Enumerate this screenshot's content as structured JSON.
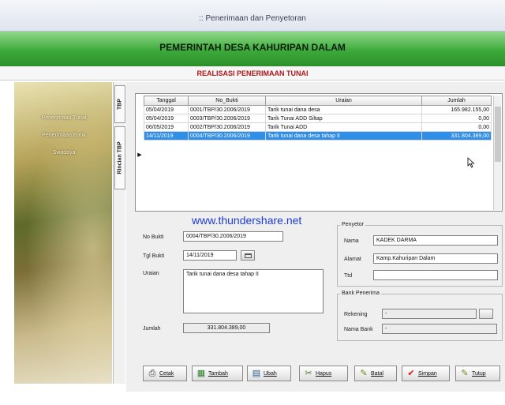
{
  "window": {
    "title": ":: Penerimaan dan Penyetoran"
  },
  "header": {
    "title": "PEMERINTAH DESA KAHURIPAN DALAM",
    "subtitle": "REALISASI PENERIMAAN TUNAI"
  },
  "sidebar": {
    "items": [
      {
        "label": "Penerimaan Tunai"
      },
      {
        "label": "Penerimaan Bank"
      },
      {
        "label": "Swadaya"
      }
    ]
  },
  "side_tabs": [
    {
      "label": "TBP"
    },
    {
      "label": "Rincian TBP"
    }
  ],
  "grid": {
    "columns": [
      "Tanggal",
      "No_Bukti",
      "Uraian",
      "Jumlah"
    ],
    "rows": [
      {
        "tanggal": "05/04/2019",
        "no_bukti": "0001/TBP/30.2006/2019",
        "uraian": "Tarik tunai dana desa",
        "jumlah": "165.982.155,00",
        "selected": false
      },
      {
        "tanggal": "05/04/2019",
        "no_bukti": "0003/TBP/30.2006/2019",
        "uraian": "Tarik Tunai ADD Siltap",
        "jumlah": "0,00",
        "selected": false
      },
      {
        "tanggal": "06/05/2019",
        "no_bukti": "0002/TBP/30.2006/2019",
        "uraian": "Tarik Tunai ADD",
        "jumlah": "0,00",
        "selected": false
      },
      {
        "tanggal": "14/11/2019",
        "no_bukti": "0004/TBP/30.2006/2019",
        "uraian": "Tarik tunai dana desa tahap II",
        "jumlah": "331.804.389,00",
        "selected": true
      }
    ]
  },
  "watermark": "www.thundershare.net",
  "form": {
    "no_bukti_label": "No Bukti",
    "no_bukti": "0004/TBP/30.2006/2019",
    "tgl_bukti_label": "Tgl Bukti",
    "tgl_bukti": "14/11/2019",
    "uraian_label": "Uraian",
    "uraian": "Tarik tunai dana desa tahap II",
    "jumlah_label": "Jumlah",
    "jumlah": "331.804.389,00"
  },
  "penyetor": {
    "title": "Penyetor",
    "nama_label": "Nama",
    "nama": "KADEK DARMA",
    "alamat_label": "Alamat",
    "alamat": "Kamp.Kahuripan Dalam",
    "ttd_label": "Ttd",
    "ttd": ""
  },
  "bank": {
    "title": "Bank Penerima",
    "rekening_label": "Rekening",
    "rekening": "-",
    "nama_bank_label": "Nama Bank",
    "nama_bank": "-"
  },
  "toolbar": {
    "cetak": "Cetak",
    "tambah": "Tambah",
    "ubah": "Ubah",
    "hapus": "Hapus",
    "batal": "Batal",
    "simpan": "Simpan",
    "tutup": "Tutup"
  },
  "colors": {
    "banner": "#3daa3a",
    "subtitle": "#b01818",
    "selection": "#2f8ee8",
    "watermark": "#1f3bd1"
  }
}
